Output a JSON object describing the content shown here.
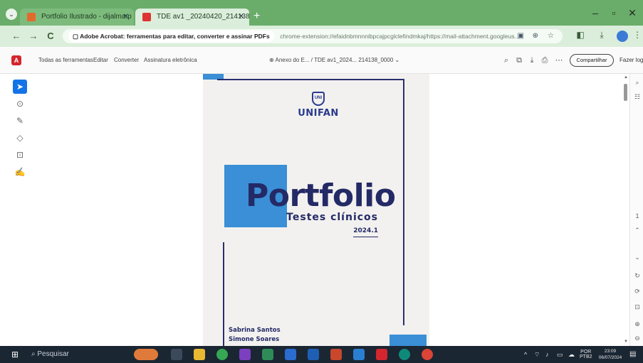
{
  "browser": {
    "tabs": [
      {
        "title": "Portfolio Ilustrado - dijalma.p",
        "active": false
      },
      {
        "title": "TDE av1 _20240420_214138_0",
        "active": true
      }
    ],
    "new_tab": "+",
    "window_controls": {
      "minimize": "–",
      "maximize": "▫",
      "close": "✕"
    },
    "nav": {
      "back": "←",
      "forward": "→",
      "reload": "C"
    },
    "site_chip": "Adobe Acrobat: ferramentas para editar, converter e assinar PDFs",
    "url": "chrome-extension://efaidnbmnnnibpcajpcglclefindmkaj/https://mail-attachment.googleus..."
  },
  "acrobat": {
    "menu": [
      "Todas as ferramentas",
      "Editar",
      "Converter",
      "Assinatura eletrônica"
    ],
    "breadcrumb": "Anexo do E...",
    "separator": "/",
    "doc_name": "TDE av1_2024... 214138_0000",
    "share_label": "Compartilhar",
    "login_label": "Fazer logo"
  },
  "pdf_page": {
    "brand": "UNIFAN",
    "shield_text": "UNI",
    "title": "Portfolio",
    "subtitle": "Testes clínicos",
    "year": "2024.1",
    "authors": [
      "Sabrina Santos",
      "Simone Soares"
    ]
  },
  "taskbar": {
    "search_placeholder": "Pesquisar",
    "language": "POR",
    "language_sub": "PTB2",
    "time": "23:09",
    "date": "06/07/2024"
  },
  "colors": {
    "browser_green": "#6aac6a",
    "accent_blue": "#3a8fd6",
    "navy": "#242a66",
    "acrobat_red": "#d3262e",
    "taskbar": "#1b2633"
  }
}
